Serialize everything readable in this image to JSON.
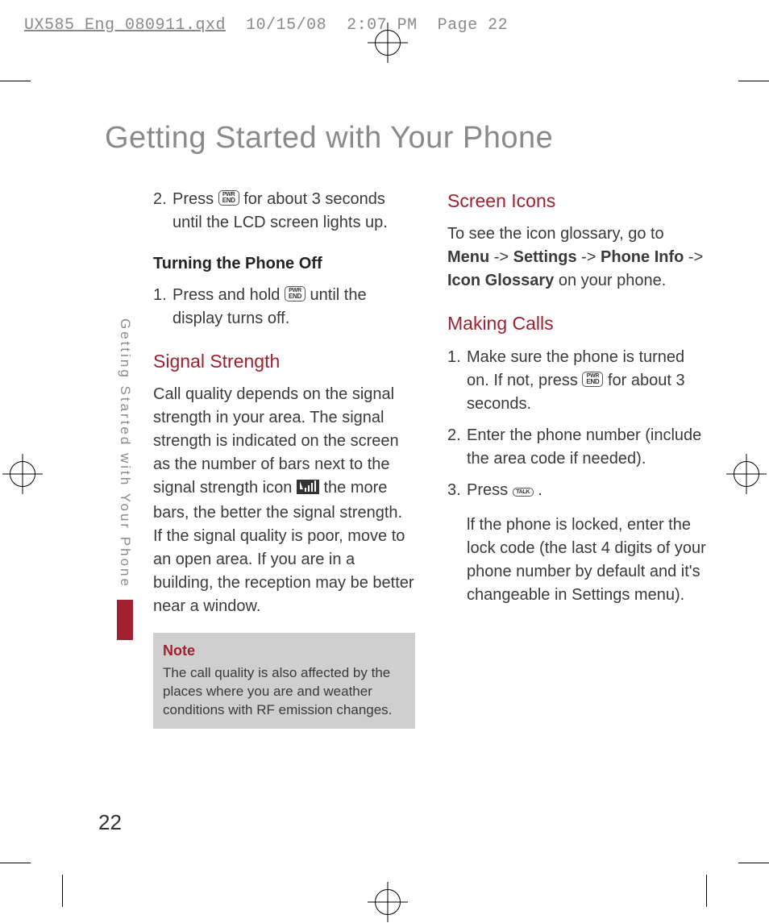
{
  "slug": {
    "filename": "UX585_Eng_080911.qxd",
    "date": "10/15/08",
    "time": "2:07 PM",
    "pagelabel": "Page 22"
  },
  "title": "Getting Started with Your Phone",
  "sidebar_label": "Getting Started with Your Phone",
  "page_number": "22",
  "left_col": {
    "step2": {
      "num": "2.",
      "pre": "Press ",
      "post": " for about 3 seconds until the LCD screen lights up."
    },
    "turning_off_heading": "Turning the Phone Off",
    "off_step1": {
      "num": "1.",
      "pre": "Press and hold ",
      "post": " until the display turns off."
    },
    "signal_heading": "Signal Strength",
    "signal_para_pre": "Call quality depends on the signal strength in your area. The signal strength is indicated on the screen as the number of bars next to the signal strength icon ",
    "signal_para_post": " the more bars, the better the signal strength. If the signal quality is poor, move to an open area. If you are in a building, the reception may be better near a window.",
    "note_title": "Note",
    "note_body": "The call quality is also affected by the places where you are and weather conditions with RF emission changes."
  },
  "right_col": {
    "screen_icons_heading": "Screen Icons",
    "screen_icons_para_pre": "To see the icon glossary, go to ",
    "nav_menu": "Menu",
    "nav_arrow": " -> ",
    "nav_settings": "Settings",
    "nav_phoneinfo": "Phone Info",
    "nav_iconglossary": "Icon Glossary",
    "screen_icons_para_post": " on your phone.",
    "making_calls_heading": "Making Calls",
    "mc1": {
      "num": "1.",
      "pre": "Make sure the phone is turned on. If not, press ",
      "post": " for about 3 seconds."
    },
    "mc2": {
      "num": "2.",
      "text": "Enter the phone number (include the area code if needed)."
    },
    "mc3": {
      "num": "3.",
      "pre": "Press ",
      "post": " ."
    },
    "mc_lock": "lf the phone is locked, enter the lock code (the last 4 digits of your phone number by default and it's changeable in Settings menu)."
  },
  "icons": {
    "pwr_end_l1": "PWR",
    "pwr_end_l2": "END",
    "talk": "TALK"
  }
}
